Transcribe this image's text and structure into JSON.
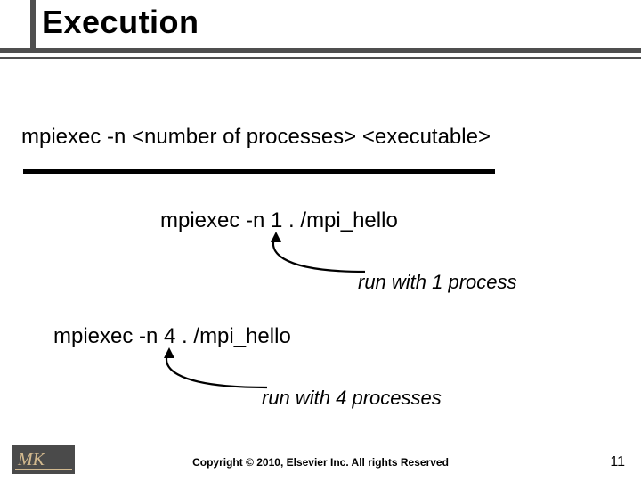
{
  "title": "Execution",
  "cmd_syntax": "mpiexec  -n  <number of processes>   <executable>",
  "cmd_example1": "mpiexec  -n  1  . /mpi_hello",
  "caption1": "run with 1 process",
  "cmd_example2": "mpiexec  -n  4  . /mpi_hello",
  "caption2": "run with 4 processes",
  "copyright": "Copyright © 2010, Elsevier Inc. All rights Reserved",
  "page_number": "11",
  "logo_letters": "MK"
}
